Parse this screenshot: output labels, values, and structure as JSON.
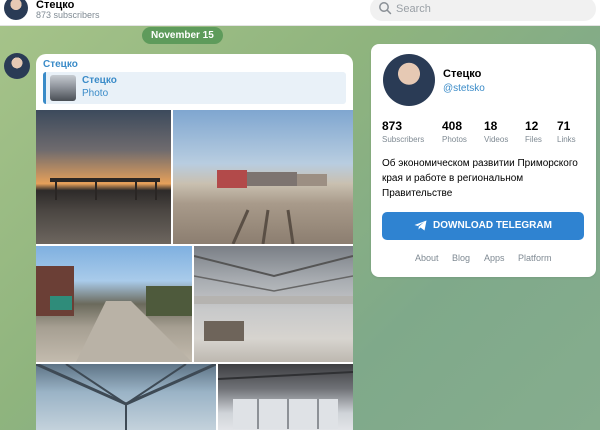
{
  "header": {
    "channel_name": "Стецко",
    "subscribers_text": "873 subscribers",
    "search_placeholder": "Search"
  },
  "date_label": "November 15",
  "message": {
    "author": "Стецко",
    "forwarded": {
      "title": "Стецко",
      "subtitle": "Photo"
    },
    "photos": [
      "photo-1",
      "photo-2",
      "photo-3",
      "photo-4",
      "photo-5",
      "photo-6"
    ]
  },
  "channel_card": {
    "name": "Стецко",
    "handle": "@stetsko",
    "stats": [
      {
        "value": "873",
        "label": "Subscribers"
      },
      {
        "value": "408",
        "label": "Photos"
      },
      {
        "value": "18",
        "label": "Videos"
      },
      {
        "value": "12",
        "label": "Files"
      },
      {
        "value": "71",
        "label": "Links"
      }
    ],
    "description": "Об экономическом развитии Приморского края и работе в региональном Правительстве",
    "download_label": "DOWNLOAD TELEGRAM",
    "footer_links": [
      "About",
      "Blog",
      "Apps",
      "Platform"
    ]
  },
  "colors": {
    "accent": "#3a8bc8",
    "button": "#2f83d1",
    "date_pill": "#5e9b5b"
  }
}
